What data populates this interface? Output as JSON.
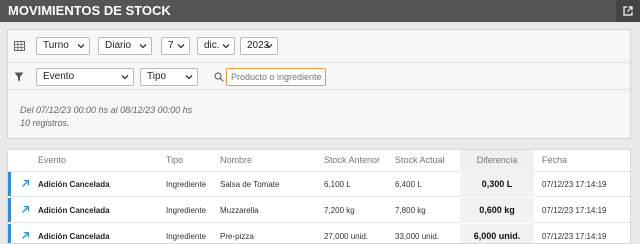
{
  "header": {
    "title": "MOVIMIENTOS DE STOCK",
    "external_icon": "external-link-icon"
  },
  "filters": {
    "row1_icon": "calendar-grid-icon",
    "turno": "Turno",
    "period": "Diario",
    "day": "7",
    "month": "dic.",
    "year": "2023",
    "row2_icon": "filter-icon",
    "evento": "Evento",
    "tipo": "Tipo",
    "search_icon": "search-icon",
    "search_placeholder": "Producto o ingrediente"
  },
  "summary": {
    "range": "Del 07/12/23 00:00 hs al 08/12/23 00:00 hs",
    "count": "10 registros."
  },
  "table": {
    "columns": [
      "Evento",
      "Tipo",
      "Nombre",
      "Stock Anterior",
      "Stock Actual",
      "Diferencia",
      "Fecha"
    ],
    "rows": [
      {
        "evento": "Adición Cancelada",
        "tipo": "Ingrediente",
        "nombre": "Salsa de Tomate",
        "anterior": "6,100 L",
        "actual": "6,400 L",
        "diferencia": "0,300 L",
        "fecha": "07/12/23 17:14:19"
      },
      {
        "evento": "Adición Cancelada",
        "tipo": "Ingrediente",
        "nombre": "Muzzarella",
        "anterior": "7,200 kg",
        "actual": "7,800 kg",
        "diferencia": "0,600 kg",
        "fecha": "07/12/23 17:14:19"
      },
      {
        "evento": "Adición Cancelada",
        "tipo": "Ingrediente",
        "nombre": "Pre-pizza",
        "anterior": "27,000 unid.",
        "actual": "33,000 unid.",
        "diferencia": "6,000 unid.",
        "fecha": "07/12/23 17:14:19"
      }
    ]
  },
  "colors": {
    "accent": "#2f8fd1",
    "titlebar": "#555555",
    "search_border": "#e89a3c"
  }
}
